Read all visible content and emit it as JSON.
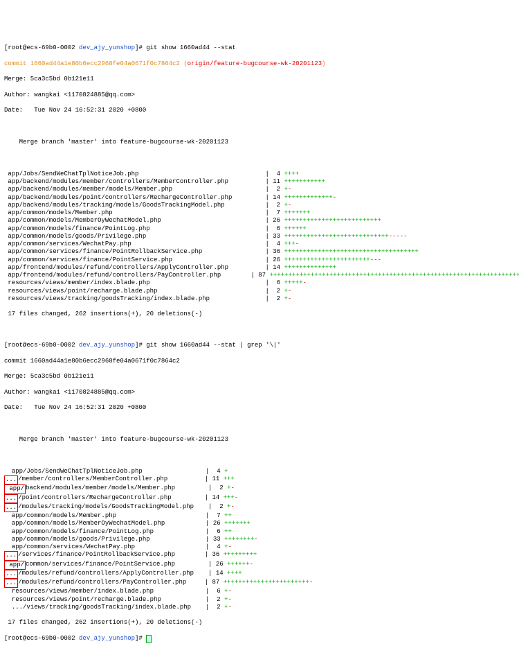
{
  "prompt1": {
    "userhost": "[root@ecs-69b0-0002 ",
    "dir": "dev_ajy_yunshop",
    "cmd": "]# git show 1660ad44 --stat"
  },
  "commit1": {
    "label": "commit ",
    "hash": "1660ad44a1e80b6ecc2968fe04a0671f0c7864c2",
    "ref_open": " (",
    "ref": "origin/feature-bugcourse-wk-20201123",
    "ref_close": ")"
  },
  "merge1": "Merge: 5ca3c5bd 0b121e11",
  "author1": "Author: wangkai <1170824885@qq.com>",
  "date1": "Date:   Tue Nov 24 16:52:31 2020 +0800",
  "msg1": "    Merge branch 'master' into feature-bugcourse-wk-20201123",
  "files1": [
    {
      "f": " app/Jobs/SendWeChatTplNoticeJob.php                              ",
      "n": "|  4 ",
      "p": "++++",
      "m": ""
    },
    {
      "f": " app/backend/modules/member/controllers/MemberController.php      ",
      "n": "| 11 ",
      "p": "+++++++++++",
      "m": ""
    },
    {
      "f": " app/backend/modules/member/models/Member.php                     ",
      "n": "|  2 ",
      "p": "+",
      "m": "-"
    },
    {
      "f": " app/backend/modules/point/controllers/RechargeController.php     ",
      "n": "| 14 ",
      "p": "+++++++++++++",
      "m": "-"
    },
    {
      "f": " app/backend/modules/tracking/models/GoodsTrackingModel.php       ",
      "n": "|  2 ",
      "p": "+",
      "m": "-"
    },
    {
      "f": " app/common/models/Member.php                                     ",
      "n": "|  7 ",
      "p": "+++++++",
      "m": ""
    },
    {
      "f": " app/common/models/MemberOyWechatModel.php                        ",
      "n": "| 26 ",
      "p": "++++++++++++++++++++++++++",
      "m": ""
    },
    {
      "f": " app/common/models/finance/PointLog.php                           ",
      "n": "|  6 ",
      "p": "++++++",
      "m": ""
    },
    {
      "f": " app/common/models/goods/Privilege.php                            ",
      "n": "| 33 ",
      "p": "++++++++++++++++++++++++++++",
      "m": "-----"
    },
    {
      "f": " app/common/services/WechatPay.php                                ",
      "n": "|  4 ",
      "p": "+++",
      "m": "-"
    },
    {
      "f": " app/common/services/finance/PointRollbackService.php             ",
      "n": "| 36 ",
      "p": "++++++++++++++++++++++++++++++++++++",
      "m": ""
    },
    {
      "f": " app/common/services/finance/PointService.php                     ",
      "n": "| 26 ",
      "p": "+++++++++++++++++++++++",
      "m": "---"
    },
    {
      "f": " app/frontend/modules/refund/controllers/ApplyController.php      ",
      "n": "| 14 ",
      "p": "++++++++++++++",
      "m": ""
    },
    {
      "f": " app/frontend/modules/refund/controllers/PayController.php        ",
      "n": "| 87 ",
      "p": "++++++++++++++++++++++++++++++++++++++++++++++++++++++++++++++++++++++++++++++++++",
      "m": "-----"
    },
    {
      "f": " resources/views/member/index.blade.php                           ",
      "n": "|  6 ",
      "p": "+++++",
      "m": "-"
    },
    {
      "f": " resources/views/point/recharge.blade.php                         ",
      "n": "|  2 ",
      "p": "+",
      "m": "-"
    },
    {
      "f": " resources/views/tracking/goodsTracking/index.blade.php           ",
      "n": "|  2 ",
      "p": "+",
      "m": "-"
    }
  ],
  "summary1": " 17 files changed, 262 insertions(+), 20 deletions(-)",
  "prompt2": {
    "userhost": "[root@ecs-69b0-0002 ",
    "dir": "dev_ajy_yunshop",
    "cmd": "]# git show 1660ad44 --stat | grep '\\|'"
  },
  "commit2": "commit 1660ad44a1e80b6ecc2968fe04a0671f0c7864c2",
  "files2": [
    {
      "mark": "",
      "f": " app/Jobs/SendWeChatTplNoticeJob.php             ",
      "n": "|  4 ",
      "p": "+",
      "m": ""
    },
    {
      "mark": "...",
      "f": "/member/controllers/MemberController.php      ",
      "n": "| 11 ",
      "p": "+++",
      "m": ""
    },
    {
      "mark": " app/",
      "f": "backend/modules/member/models/Member.php     ",
      "n": "|  2 ",
      "p": "+",
      "m": "-"
    },
    {
      "mark": "...",
      "f": "/point/controllers/RechargeController.php     ",
      "n": "| 14 ",
      "p": "+++",
      "m": "-"
    },
    {
      "mark": "...",
      "f": "/modules/tracking/models/GoodsTrackingModel.php",
      "n": "|  2 ",
      "p": "+",
      "m": "-"
    },
    {
      "mark": "",
      "f": " app/common/models/Member.php                    ",
      "n": "|  7 ",
      "p": "++",
      "m": ""
    },
    {
      "mark": "",
      "f": " app/common/models/MemberOyWechatModel.php       ",
      "n": "| 26 ",
      "p": "+++++++",
      "m": ""
    },
    {
      "mark": "",
      "f": " app/common/models/finance/PointLog.php          ",
      "n": "|  6 ",
      "p": "++",
      "m": ""
    },
    {
      "mark": "",
      "f": " app/common/models/goods/Privilege.php           ",
      "n": "| 33 ",
      "p": "++++++++",
      "m": "-"
    },
    {
      "mark": "",
      "f": " app/common/services/WechatPay.php               ",
      "n": "|  4 ",
      "p": "+",
      "m": "-"
    },
    {
      "mark": "...",
      "f": "/services/finance/PointRollbackService.php    ",
      "n": "| 36 ",
      "p": "+++++++++",
      "m": ""
    },
    {
      "mark": " app/",
      "f": "common/services/finance/PointService.php     ",
      "n": "| 26 ",
      "p": "++++++",
      "m": "-"
    },
    {
      "mark": "...",
      "f": "/modules/refund/controllers/ApplyController.php",
      "n": "| 14 ",
      "p": "++++",
      "m": ""
    },
    {
      "mark": "...",
      "f": "/modules/refund/controllers/PayController.php ",
      "n": "| 87 ",
      "p": "+++++++++++++++++++++++",
      "m": "-"
    },
    {
      "mark": "",
      "f": " resources/views/member/index.blade.php          ",
      "n": "|  6 ",
      "p": "+",
      "m": "-"
    },
    {
      "mark": "",
      "f": " resources/views/point/recharge.blade.php        ",
      "n": "|  2 ",
      "p": "+",
      "m": "-"
    },
    {
      "mark": "",
      "f": " .../views/tracking/goodsTracking/index.blade.php",
      "n": "|  2 ",
      "p": "+",
      "m": "-"
    }
  ],
  "prompt3": {
    "userhost": "[root@ecs-69b0-0002 ",
    "dir": "dev_ajy_yunshop",
    "cmd": "]# "
  }
}
